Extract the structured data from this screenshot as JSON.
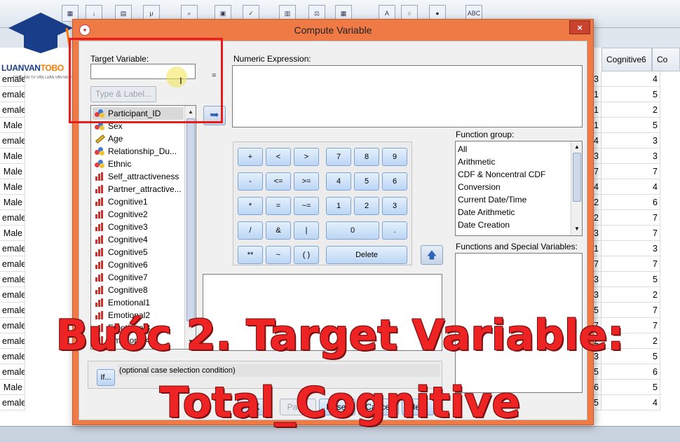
{
  "dialog": {
    "title": "Compute Variable",
    "close_label": "×",
    "target_label": "Target Variable:",
    "target_value": "",
    "equals": "=",
    "type_label_button": "Type & Label...",
    "numeric_expression_label": "Numeric Expression:",
    "variables": [
      {
        "name": "Participant_ID",
        "type": "nominal",
        "selected": true
      },
      {
        "name": "Sex",
        "type": "nominal",
        "selected": false
      },
      {
        "name": "Age",
        "type": "scale-ruler",
        "selected": false
      },
      {
        "name": "Relationship_Du...",
        "type": "nominal",
        "selected": false
      },
      {
        "name": "Ethnic",
        "type": "nominal",
        "selected": false
      },
      {
        "name": "Self_attractiveness",
        "type": "scale",
        "selected": false
      },
      {
        "name": "Partner_attractive...",
        "type": "scale",
        "selected": false
      },
      {
        "name": "Cognitive1",
        "type": "scale",
        "selected": false
      },
      {
        "name": "Cognitive2",
        "type": "scale",
        "selected": false
      },
      {
        "name": "Cognitive3",
        "type": "scale",
        "selected": false
      },
      {
        "name": "Cognitive4",
        "type": "scale",
        "selected": false
      },
      {
        "name": "Cognitive5",
        "type": "scale",
        "selected": false
      },
      {
        "name": "Cognitive6",
        "type": "scale",
        "selected": false
      },
      {
        "name": "Cognitive7",
        "type": "scale",
        "selected": false
      },
      {
        "name": "Cognitive8",
        "type": "scale",
        "selected": false
      },
      {
        "name": "Emotional1",
        "type": "scale",
        "selected": false
      },
      {
        "name": "Emotional2",
        "type": "scale",
        "selected": false
      },
      {
        "name": "Emotional3",
        "type": "scale",
        "selected": false
      },
      {
        "name": "Emotional4",
        "type": "scale",
        "selected": false
      }
    ],
    "keypad": [
      [
        "+",
        "<",
        ">",
        "7",
        "8",
        "9"
      ],
      [
        "-",
        "<=",
        ">=",
        "4",
        "5",
        "6"
      ],
      [
        "*",
        "=",
        "~=",
        "1",
        "2",
        "3"
      ],
      [
        "/",
        "&",
        "|",
        "0",
        "."
      ],
      [
        "**",
        "~",
        "( )",
        "Delete"
      ]
    ],
    "function_group_label": "Function group:",
    "function_groups": [
      "All",
      "Arithmetic",
      "CDF & Noncentral CDF",
      "Conversion",
      "Current Date/Time",
      "Date Arithmetic",
      "Date Creation"
    ],
    "functions_special_label": "Functions and Special Variables:",
    "if_button": "If...",
    "if_text": "(optional case selection condition)",
    "buttons": {
      "ok": "OK",
      "paste": "Paste",
      "reset": "Reset",
      "cancel": "Cancel",
      "help": "Help"
    }
  },
  "background": {
    "logo_main": "LUANVAN",
    "logo_accent": "TOBO",
    "logo_sub": "TỔNG ĐÀI TƯ VẤN LUẬN VĂN NGHI",
    "left_column": [
      "emale",
      "emale",
      "emale",
      "Male",
      "emale",
      "Male",
      "Male",
      "Male",
      "Male",
      "emale",
      "Male",
      "emale",
      "emale",
      "emale",
      "emale",
      "emale",
      "emale",
      "emale",
      "emale",
      "emale",
      "Male",
      "emale"
    ],
    "header_right": [
      "Cognitive6",
      "Co"
    ],
    "left_partial_col": [
      "3",
      "1",
      "1",
      "1",
      "4",
      "3",
      "7",
      "4",
      "2",
      "2",
      "3",
      "1",
      "7",
      "3",
      "3",
      "5",
      "7",
      "2",
      "3",
      "5",
      "6",
      "5"
    ],
    "right_col": [
      "4",
      "5",
      "2",
      "5",
      "3",
      "3",
      "7",
      "4",
      "6",
      "7",
      "7",
      "3",
      "7",
      "5",
      "2",
      "7",
      "7",
      "2",
      "5",
      "6",
      "5",
      "4"
    ]
  },
  "caption": {
    "line1": "Bước 2. Target Variable:",
    "line2": "Total_Cognitive"
  },
  "colors": {
    "dialog_frame": "#f07a45",
    "caption_red": "#ee2424",
    "highlight_rect": "#e51d1d"
  }
}
